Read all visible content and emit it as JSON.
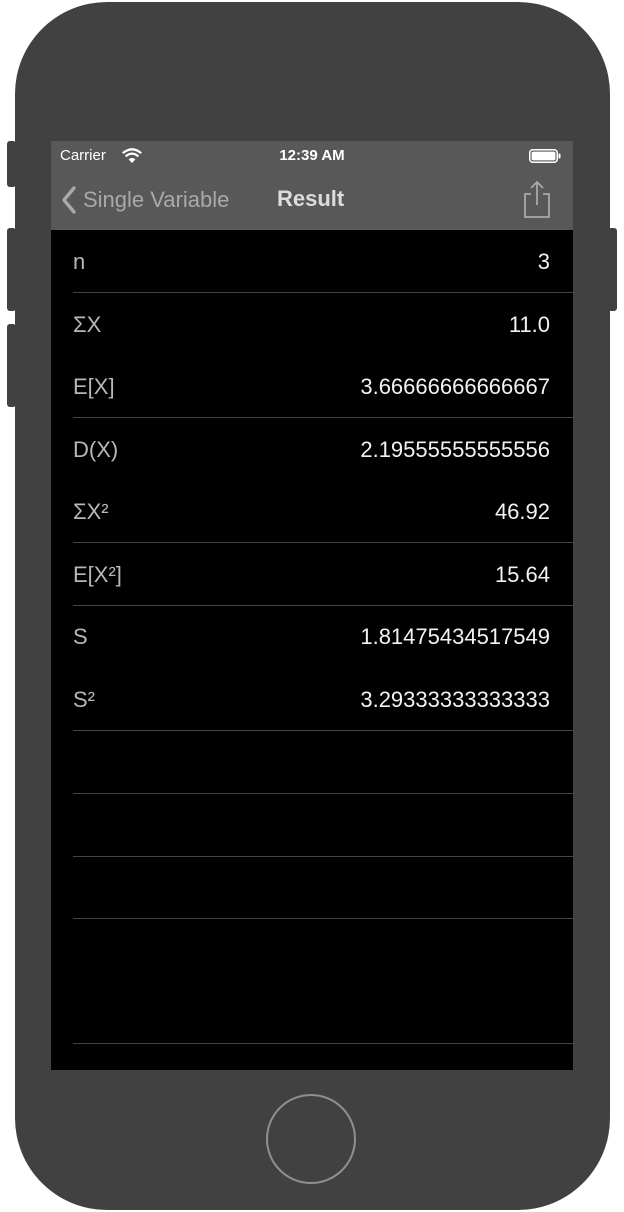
{
  "status_bar": {
    "carrier": "Carrier",
    "time": "12:39 AM",
    "wifi_icon": "wifi-icon",
    "battery_icon": "battery-icon"
  },
  "nav": {
    "back_label": "Single Variable",
    "back_icon": "chevron-left-icon",
    "title": "Result",
    "share_icon": "share-icon"
  },
  "results": [
    {
      "label": "n",
      "value": "3"
    },
    {
      "label": "ΣX",
      "value": "11.0"
    },
    {
      "label": "E[X]",
      "value": "3.66666666666667"
    },
    {
      "label": "D(X)",
      "value": "2.19555555555556"
    },
    {
      "label": "ΣX²",
      "value": "46.92"
    },
    {
      "label": "E[X²]",
      "value": "15.64"
    },
    {
      "label": "S",
      "value": "1.81475434517549"
    },
    {
      "label": "S²",
      "value": "3.29333333333333"
    }
  ],
  "colors": {
    "device": "#414141",
    "bar": "#585858",
    "screen": "#000000",
    "separator": "#444444"
  }
}
